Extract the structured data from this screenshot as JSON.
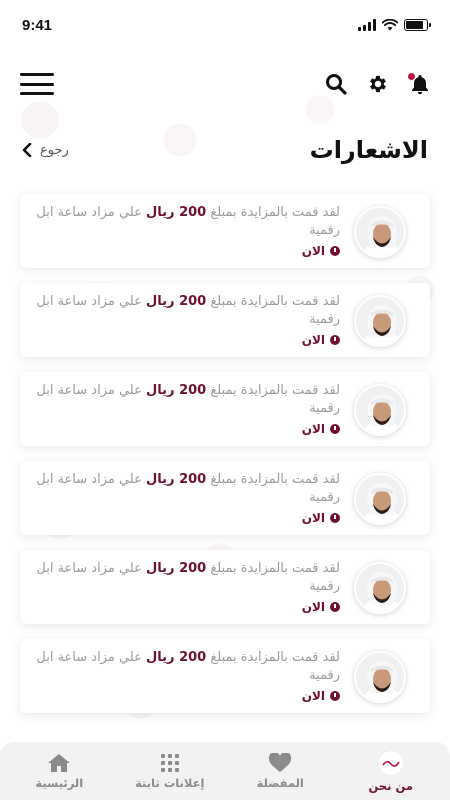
{
  "status_bar": {
    "time": "9:41"
  },
  "header": {
    "icons": {
      "menu": "hamburger-menu-icon",
      "search": "search-icon",
      "settings": "gear-icon",
      "notifications": "bell-icon"
    },
    "accent_color": "#c0143c"
  },
  "page": {
    "title": "الاشعارات",
    "back_label": "رجوع"
  },
  "notifications": [
    {
      "message_prefix": "لقد قمت بالمزايدة بمبلغ",
      "amount": "200 ريال",
      "message_suffix": "علي مزاد ساعة ابل رقمية",
      "time": "الان"
    },
    {
      "message_prefix": "لقد قمت بالمزايدة بمبلغ",
      "amount": "200 ريال",
      "message_suffix": "علي مزاد ساعة ابل رقمية",
      "time": "الان"
    },
    {
      "message_prefix": "لقد قمت بالمزايدة بمبلغ",
      "amount": "200 ريال",
      "message_suffix": "علي مزاد ساعة ابل رقمية",
      "time": "الان"
    },
    {
      "message_prefix": "لقد قمت بالمزايدة بمبلغ",
      "amount": "200 ريال",
      "message_suffix": "علي مزاد ساعة ابل رقمية",
      "time": "الان"
    },
    {
      "message_prefix": "لقد قمت بالمزايدة بمبلغ",
      "amount": "200 ريال",
      "message_suffix": "علي مزاد ساعة ابل رقمية",
      "time": "الان"
    },
    {
      "message_prefix": "لقد قمت بالمزايدة بمبلغ",
      "amount": "200 ريال",
      "message_suffix": "علي مزاد ساعة ابل رقمية",
      "time": "الان"
    }
  ],
  "bottom_nav": {
    "items": [
      {
        "label": "الرئيسية",
        "icon": "home-icon"
      },
      {
        "label": "إعلانات ثابتة",
        "icon": "grid-icon"
      },
      {
        "label": "المفضلة",
        "icon": "heart-icon"
      },
      {
        "label": "من نحن",
        "icon": "brand-logo-icon"
      }
    ]
  },
  "colors": {
    "brand": "#6e1030",
    "muted_text": "#9a9a9a",
    "nav_bg": "#f2f2f2"
  }
}
